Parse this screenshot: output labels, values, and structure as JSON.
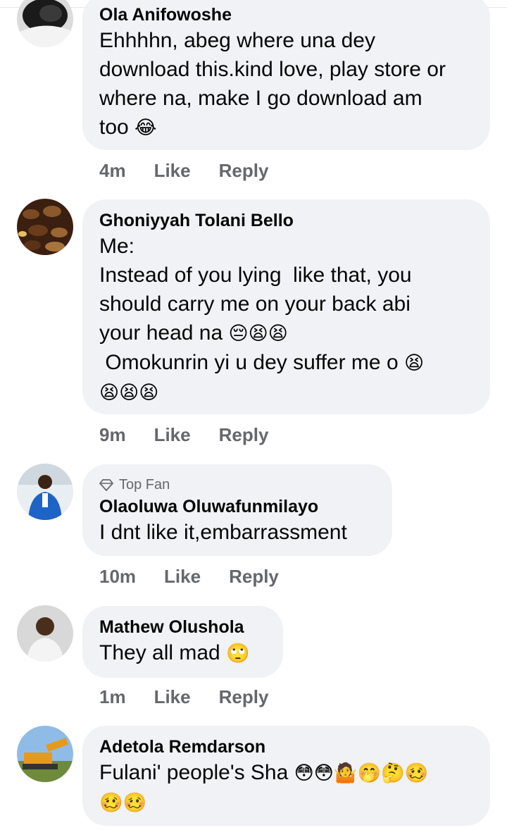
{
  "comments": [
    {
      "name": "Ola Anifowoshe",
      "text": "Ehhhhn, abeg where una dey download this.kind love, play store or where na, make I go download am too 😂",
      "time": "4m",
      "like": "Like",
      "reply": "Reply"
    },
    {
      "name": "Ghoniyyah Tolani Bello",
      "text": "Me:\nInstead of you lying  like that, you should carry me on your back abi your head na 😔😫😫\n Omokunrin yi u dey suffer me o 😫\n😫😫😫",
      "time": "9m",
      "like": "Like",
      "reply": "Reply"
    },
    {
      "badge": "Top Fan",
      "name": "Olaoluwa Oluwafunmilayo",
      "text": "I dnt like it,embarrassment",
      "time": "10m",
      "like": "Like",
      "reply": "Reply"
    },
    {
      "name": "Mathew Olushola",
      "text": "They all mad 🙄",
      "time": "1m",
      "like": "Like",
      "reply": "Reply"
    },
    {
      "name": "Adetola Remdarson",
      "text": "Fulani' people's Sha 😳😳🤷🤭🤔🥴\n🥴🥴",
      "time": "",
      "like": "",
      "reply": ""
    }
  ],
  "colors": {
    "bubble": "#f0f2f5",
    "meta": "#65676b",
    "text": "#050505"
  },
  "icons": {
    "top_fan": "diamond-icon"
  }
}
